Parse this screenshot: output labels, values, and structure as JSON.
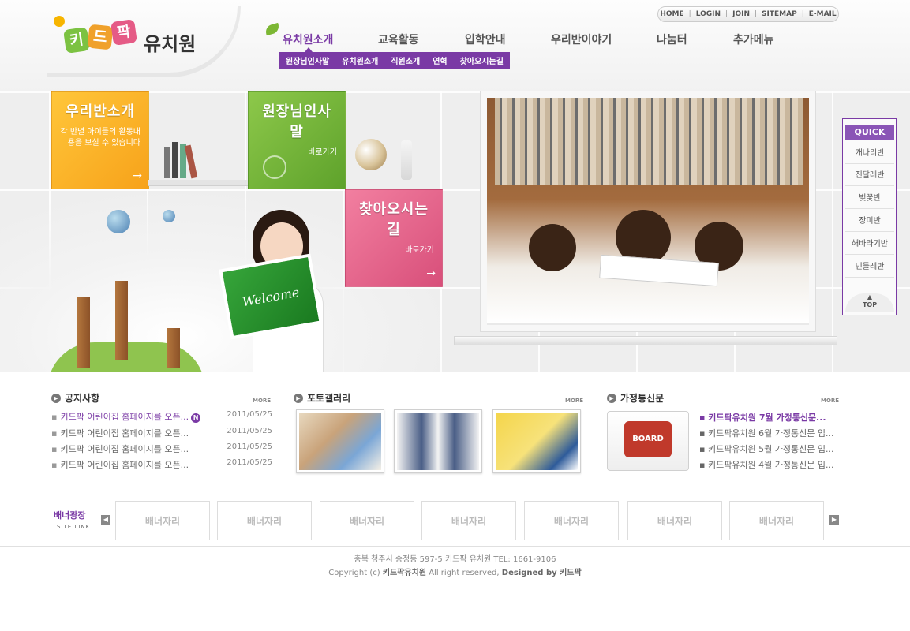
{
  "logo": {
    "chars": [
      "키",
      "드",
      "팍"
    ],
    "text": "유치원",
    "colors": [
      "#7cc242",
      "#f0a12b",
      "#e55b86"
    ]
  },
  "util": {
    "items": [
      "HOME",
      "LOGIN",
      "JOIN",
      "SITEMAP",
      "E-MAIL"
    ]
  },
  "gnb": {
    "items": [
      "유치원소개",
      "교육활동",
      "입학안내",
      "우리반이야기",
      "나눔터",
      "추가메뉴"
    ],
    "active_color": "#7a3aa5"
  },
  "subnav": {
    "items": [
      "원장님인사말",
      "유치원소개",
      "직원소개",
      "연혁",
      "찾아오시는길"
    ]
  },
  "tiles": {
    "class": {
      "title": "우리반소개",
      "desc": "각 반별 아이들의 활동내용을 보실 수 있습니다",
      "arrow": "→"
    },
    "greet": {
      "title": "원장님인사말",
      "desc": "바로가기",
      "arrow": "→"
    },
    "map": {
      "title": "찾아오시는길",
      "desc": "바로가기",
      "arrow": "→"
    }
  },
  "welcome": "Welcome",
  "quick": {
    "title": "QUICK",
    "items": [
      "개나리반",
      "진달래반",
      "벚꽃반",
      "장미반",
      "해바라기반",
      "민들레반"
    ],
    "top": "TOP"
  },
  "notice": {
    "title": "공지사항",
    "more": "MORE",
    "rows": [
      {
        "text": "키드팍 어린이집 홈페이지를 오픈...",
        "date": "2011/05/25",
        "new": "N"
      },
      {
        "text": "키드팍 어린이집 홈페이지를 오픈...",
        "date": "2011/05/25"
      },
      {
        "text": "키드팍 어린이집 홈페이지를 오픈...",
        "date": "2011/05/25"
      },
      {
        "text": "키드팍 어린이집 홈페이지를 오픈...",
        "date": "2011/05/25"
      }
    ]
  },
  "gallery": {
    "title": "포토갤러리",
    "more": "MORE"
  },
  "newsletter": {
    "title": "가정통신문",
    "more": "MORE",
    "board_label": "BOARD",
    "rows": [
      "키드팍유치원 7월 가정통신문...",
      "키드팍유치원 6월 가정통신문 입...",
      "키드팍유치원 5월 가정통신문 입...",
      "키드팍유치원 4월 가정통신문 입..."
    ]
  },
  "banner": {
    "title": "배너광장",
    "sub": "SITE LINK",
    "prev": "◀",
    "next": "▶",
    "items": [
      "배너자리",
      "배너자리",
      "배너자리",
      "배너자리",
      "배너자리",
      "배너자리",
      "배너자리"
    ]
  },
  "footer": {
    "address": "충북 청주시 송정동 597-5 키드팍 유치원   TEL: 1661-9106",
    "copy_prefix": "Copyright (c)",
    "copy_name": "키드팍유치원",
    "copy_mid": "All right reserved,",
    "copy_design": "Designed by 키드팍"
  }
}
